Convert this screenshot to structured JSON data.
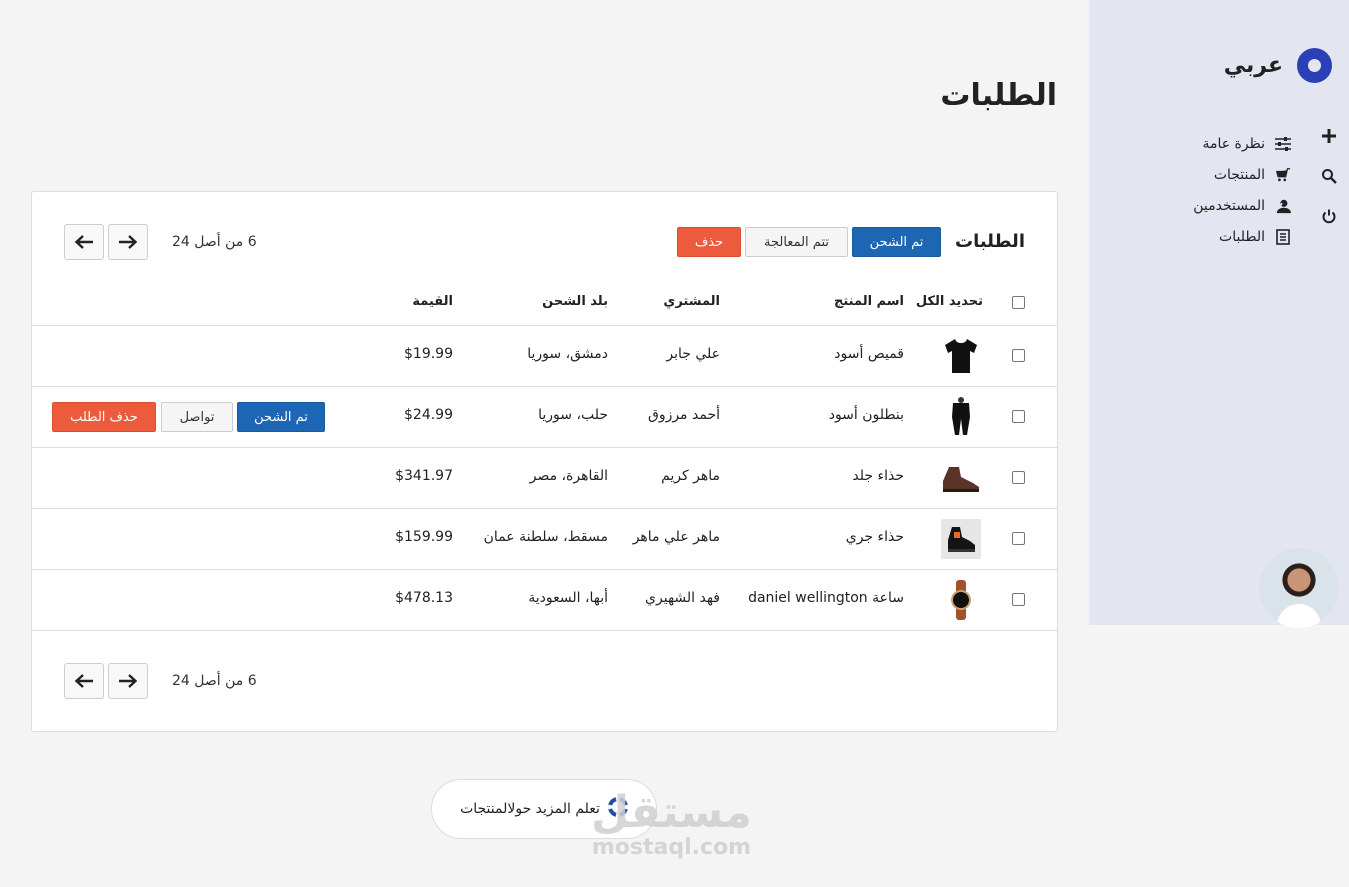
{
  "brand": {
    "name": "عربي"
  },
  "sidebar": {
    "items": [
      {
        "label": "نظرة عامة"
      },
      {
        "label": "المنتجات"
      },
      {
        "label": "المستخدمين"
      },
      {
        "label": "الطلبات"
      }
    ]
  },
  "page": {
    "title": "الطلبات"
  },
  "card": {
    "title": "الطلبات",
    "toolbar": {
      "shipped": "تم الشحن",
      "processing": "تتم المعالجة",
      "delete": "حذف"
    },
    "pager_text": "6 من أصل 24",
    "columns": {
      "select_all": "تحديد الكل",
      "product": "اسم المنتج",
      "buyer": "المشتري",
      "country": "بلد الشحن",
      "value": "القيمة"
    },
    "row_actions": {
      "shipped": "تم الشحن",
      "contact": "تواصل",
      "delete": "حذف الطلب"
    },
    "rows": [
      {
        "product": "قميص أسود",
        "buyer": "علي جابر",
        "country": "دمشق، سوريا",
        "value": "$19.99"
      },
      {
        "product": "بنطلون أسود",
        "buyer": "أحمد مرزوق",
        "country": "حلب، سوريا",
        "value": "$24.99"
      },
      {
        "product": "حذاء جلد",
        "buyer": "ماهر كريم",
        "country": "القاهرة، مصر",
        "value": "$341.97"
      },
      {
        "product": "حذاء جري",
        "buyer": "ماهر علي ماهر",
        "country": "مسقط، سلطنة عمان",
        "value": "$159.99"
      },
      {
        "product": "ساعة daniel wellington",
        "buyer": "فهد الشهيري",
        "country": "أبها، السعودية",
        "value": "$478.13"
      }
    ]
  },
  "help": {
    "label": "تعلم المزيد حولالمنتجات"
  },
  "watermark": {
    "arabic": "مستقل",
    "latin": "mostaql.com"
  },
  "colors": {
    "sidebar_bg": "#e3e5f0",
    "accent": "#2b3fb6",
    "primary_btn": "#1d66b4",
    "danger_btn": "#eb5b3c"
  }
}
